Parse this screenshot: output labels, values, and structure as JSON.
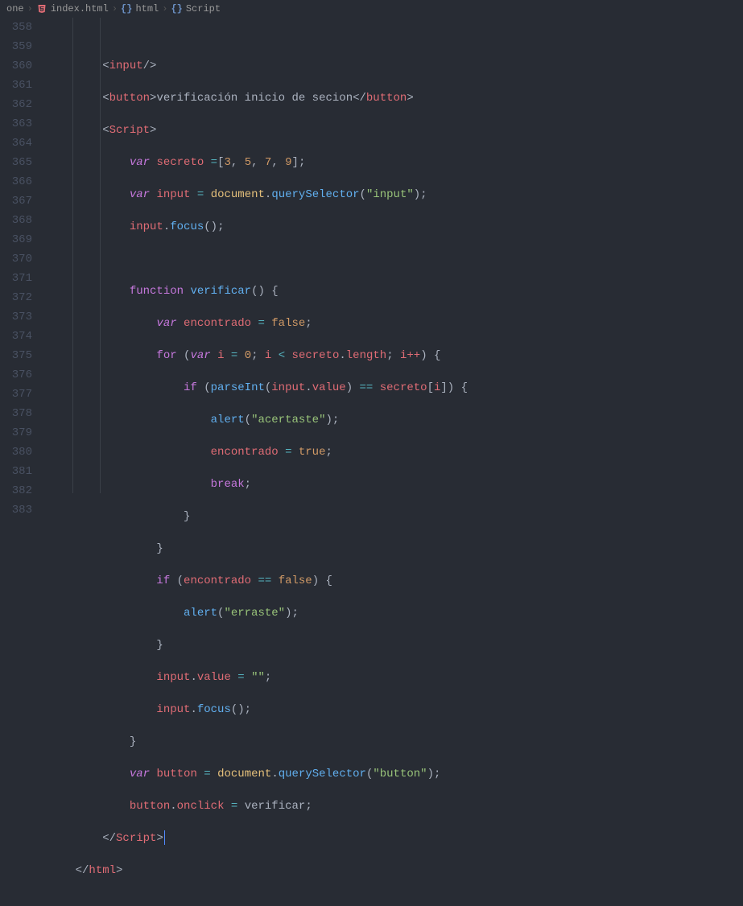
{
  "breadcrumb": {
    "items": [
      "one",
      "index.html",
      "html",
      "Script"
    ]
  },
  "lines": [
    358,
    359,
    360,
    361,
    362,
    363,
    364,
    365,
    366,
    367,
    368,
    369,
    370,
    371,
    372,
    373,
    374,
    375,
    376,
    377,
    378,
    379,
    380,
    381,
    382,
    383
  ],
  "code": {
    "l358": {
      "tag_close": "input",
      "suffix": "/>"
    },
    "l359": {
      "tag": "button",
      "text": "verificación inicio de secion"
    },
    "l360": {
      "tag": "Script"
    },
    "l361": {
      "kw": "var",
      "name": "secreto",
      "op": "=",
      "arr": [
        "3",
        "5",
        "7",
        "9"
      ]
    },
    "l362": {
      "kw": "var",
      "name": "input",
      "op": "=",
      "obj": "document",
      "fn": "querySelector",
      "arg": "\"input\""
    },
    "l363": {
      "obj": "input",
      "fn": "focus"
    },
    "l365": {
      "kw": "function",
      "name": "verificar"
    },
    "l366": {
      "kw": "var",
      "name": "encontrado",
      "op": "=",
      "val": "false"
    },
    "l367": {
      "kw": "for",
      "kw2": "var",
      "v": "i",
      "start": "0",
      "cond_v": "i",
      "cond_op": "<",
      "cond_obj": "secreto",
      "cond_prop": "length",
      "inc": "i++"
    },
    "l368": {
      "kw": "if",
      "fn": "parseInt",
      "obj": "input",
      "prop": "value",
      "op": "==",
      "arr": "secreto",
      "idx": "i"
    },
    "l369": {
      "fn": "alert",
      "arg": "\"acertaste\""
    },
    "l370": {
      "name": "encontrado",
      "op": "=",
      "val": "true"
    },
    "l371": {
      "kw": "break"
    },
    "l374": {
      "kw": "if",
      "name": "encontrado",
      "op": "==",
      "val": "false"
    },
    "l375": {
      "fn": "alert",
      "arg": "\"erraste\""
    },
    "l377": {
      "obj": "input",
      "prop": "value",
      "op": "=",
      "val": "\"\""
    },
    "l378": {
      "obj": "input",
      "fn": "focus"
    },
    "l380": {
      "kw": "var",
      "name": "button",
      "op": "=",
      "obj": "document",
      "fn": "querySelector",
      "arg": "\"button\""
    },
    "l381": {
      "obj": "button",
      "prop": "onclick",
      "op": "=",
      "val": "verificar"
    },
    "l382": {
      "tag": "Script"
    },
    "l383": {
      "tag": "html"
    }
  }
}
